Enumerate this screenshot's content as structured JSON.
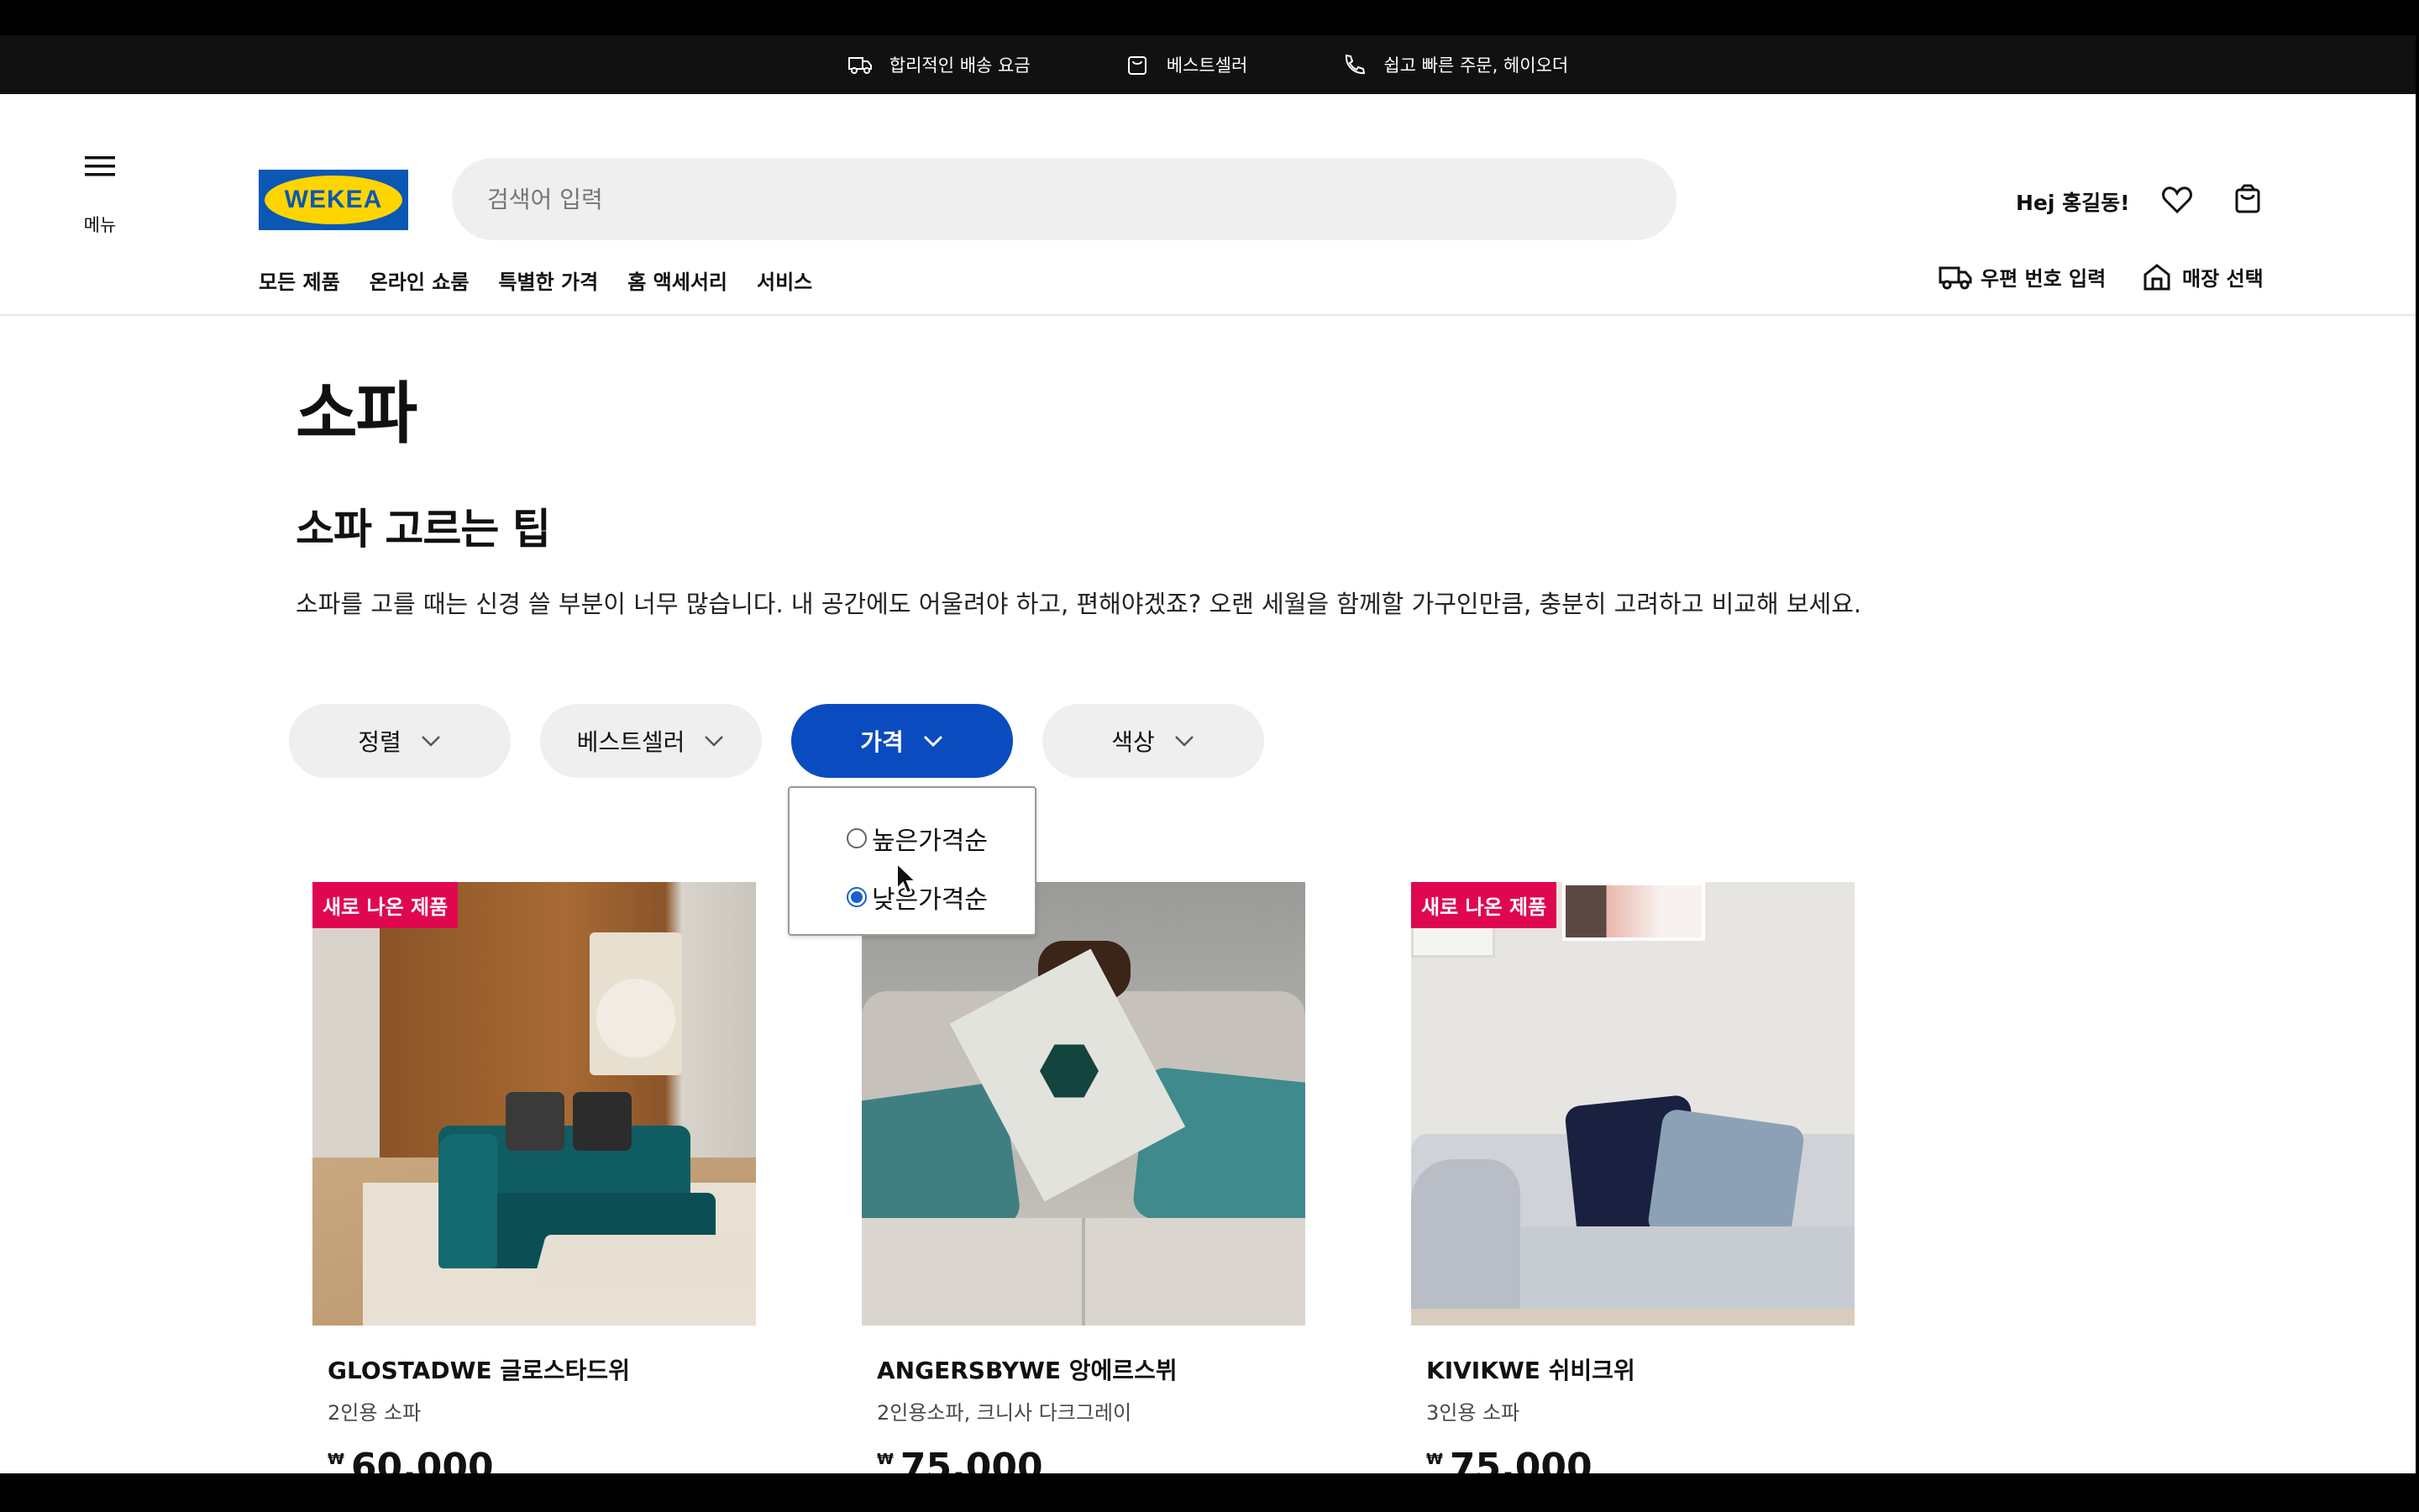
{
  "promo": {
    "items": [
      {
        "icon": "truck-icon",
        "label": "합리적인 배송 요금"
      },
      {
        "icon": "shopping-bag-icon",
        "label": "베스트셀러"
      },
      {
        "icon": "phone-icon",
        "label": "쉽고 빠른 주문, 헤이오더"
      }
    ]
  },
  "header": {
    "menu_label": "메뉴",
    "logo_text": "WEKEA",
    "search_placeholder": "검색어 입력",
    "greeting": "Hej 홍길동!",
    "nav": [
      "모든 제품",
      "온라인 쇼룸",
      "특별한 가격",
      "홈 액세서리",
      "서비스"
    ],
    "postcode_label": "우편 번호 입력",
    "store_label": "매장 선택"
  },
  "page": {
    "title": "소파",
    "tips_title": "소파 고르는 팁",
    "tips_body": "소파를 고를 때는 신경 쓸 부분이 너무 많습니다. 내 공간에도 어울려야 하고, 편해야겠죠? 오랜 세월을 함께할 가구인만큼, 충분히 고려하고 비교해 보세요."
  },
  "filters": [
    {
      "label": "정렬",
      "active": false
    },
    {
      "label": "베스트셀러",
      "active": false
    },
    {
      "label": "가격",
      "active": true
    },
    {
      "label": "색상",
      "active": false
    }
  ],
  "price_dropdown": {
    "options": [
      {
        "label": "높은가격순",
        "checked": false
      },
      {
        "label": "낮은가격순",
        "checked": true
      }
    ]
  },
  "products": [
    {
      "badge": "새로 나온 제품",
      "name": "GLOSTADWE 글로스타드위",
      "desc": "2인용 소파",
      "currency": "₩",
      "price": "60,000"
    },
    {
      "badge": "",
      "name": "ANGERSBYWE 앙에르스뷔",
      "desc": "2인용소파, 크니사 다크그레이",
      "currency": "₩",
      "price": "75,000"
    },
    {
      "badge": "새로 나온 제품",
      "name": "KIVIKWE 쉬비크위",
      "desc": "3인용 소파",
      "currency": "₩",
      "price": "75,000"
    }
  ],
  "colors": {
    "accent": "#0a4cbf",
    "badge": "#e00751",
    "logo_blue": "#0a58b4",
    "logo_yellow": "#ffd500"
  }
}
